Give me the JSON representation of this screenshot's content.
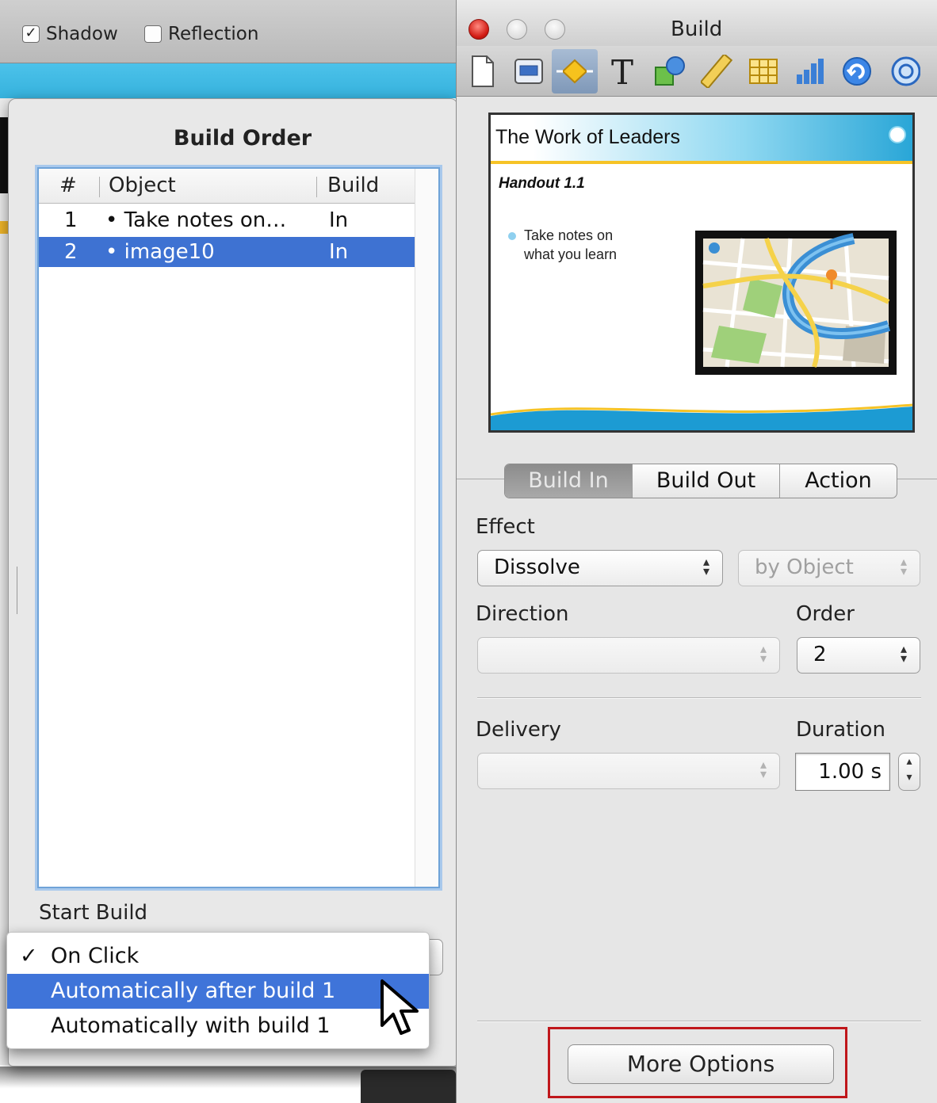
{
  "background": {
    "shadow_checkbox": {
      "label": "Shadow",
      "checked": true
    },
    "reflection_checkbox": {
      "label": "Reflection",
      "checked": false
    }
  },
  "build_order": {
    "title": "Build Order",
    "columns": [
      "#",
      "Object",
      "Build"
    ],
    "rows": [
      {
        "num": "1",
        "object": "• Take notes on…",
        "build": "In",
        "selected": false
      },
      {
        "num": "2",
        "object": "• image10",
        "build": "In",
        "selected": true
      }
    ],
    "start_build_label": "Start Build",
    "start_build_menu": [
      {
        "label": "On Click",
        "checked": true,
        "highlighted": false
      },
      {
        "label": "Automatically after build 1",
        "checked": false,
        "highlighted": true
      },
      {
        "label": "Automatically with build 1",
        "checked": false,
        "highlighted": false
      }
    ]
  },
  "inspector": {
    "title": "Build",
    "tools": [
      "document-icon",
      "slide-icon",
      "build-icon",
      "text-icon",
      "shapes-icon",
      "metrics-icon",
      "table-icon",
      "chart-icon",
      "hyperlink-icon",
      "quicktime-icon"
    ],
    "active_tool": "build-icon",
    "slide": {
      "title": "The Work of Leaders",
      "handout": "Handout 1.1",
      "bullet_line1": "Take notes on",
      "bullet_line2": "what you learn"
    },
    "tabs": [
      "Build In",
      "Build Out",
      "Action"
    ],
    "active_tab": "Build In",
    "effect_label": "Effect",
    "effect_value": "Dissolve",
    "by_object_value": "by Object",
    "direction_label": "Direction",
    "direction_value": "",
    "order_label": "Order",
    "order_value": "2",
    "delivery_label": "Delivery",
    "delivery_value": "",
    "duration_label": "Duration",
    "duration_value": "1.00 s",
    "more_options_label": "More Options",
    "highlight_color": "#c0171b",
    "selection_color": "#3e72d2"
  },
  "glyphs": {
    "checkmark": "✓",
    "up_down": "▴\n▾"
  }
}
